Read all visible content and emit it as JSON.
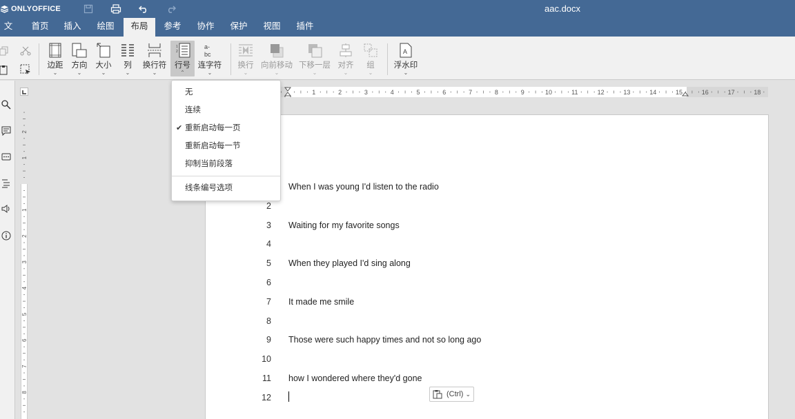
{
  "app": {
    "brand": "ONLYOFFICE",
    "doc_title": "aac.docx"
  },
  "menu": {
    "tabs": [
      "文件",
      "首页",
      "插入",
      "绘图",
      "布局",
      "参考",
      "协作",
      "保护",
      "视图",
      "插件"
    ],
    "active": "布局"
  },
  "toolbar": {
    "margins": "边距",
    "orientation": "方向",
    "size": "大小",
    "columns": "列",
    "breaks": "换行符",
    "line_numbers": "行号",
    "hyphenation": "连字符",
    "wrap": "换行",
    "bring_forward": "向前移动",
    "send_backward": "下移一层",
    "align": "对齐",
    "group": "组",
    "watermark": "浮水印"
  },
  "line_numbers_menu": {
    "items": [
      "无",
      "连续",
      "重新启动每一页",
      "重新启动每一节",
      "抑制当前段落"
    ],
    "checked": "重新启动每一页",
    "options": "线条编号选项"
  },
  "hruler_ticks": [
    "1",
    "2",
    "3",
    "4",
    "5",
    "6",
    "7",
    "8",
    "9",
    "10",
    "11",
    "12",
    "13",
    "14",
    "15",
    "16",
    "17",
    "18"
  ],
  "vruler_ticks": [
    "2",
    "1",
    "1",
    "2",
    "3",
    "4",
    "5",
    "6",
    "7",
    "8",
    "9"
  ],
  "document": {
    "lines": [
      {
        "num": "",
        "text": "When I was young I'd listen to the radio"
      },
      {
        "num": "2",
        "text": ""
      },
      {
        "num": "3",
        "text": "Waiting for my favorite songs"
      },
      {
        "num": "4",
        "text": ""
      },
      {
        "num": "5",
        "text": "When they played I'd sing along"
      },
      {
        "num": "6",
        "text": ""
      },
      {
        "num": "7",
        "text": "It made me smile"
      },
      {
        "num": "8",
        "text": ""
      },
      {
        "num": "9",
        "text": "Those were such happy times and not so long ago"
      },
      {
        "num": "10",
        "text": ""
      },
      {
        "num": "11",
        "text": "how I wondered where they'd gone"
      },
      {
        "num": "12",
        "text": ""
      }
    ]
  },
  "paste": {
    "label": "(Ctrl)"
  },
  "colors": {
    "header": "#446995",
    "toolbar": "#f1f1f1",
    "workspace": "#e2e2e2"
  }
}
